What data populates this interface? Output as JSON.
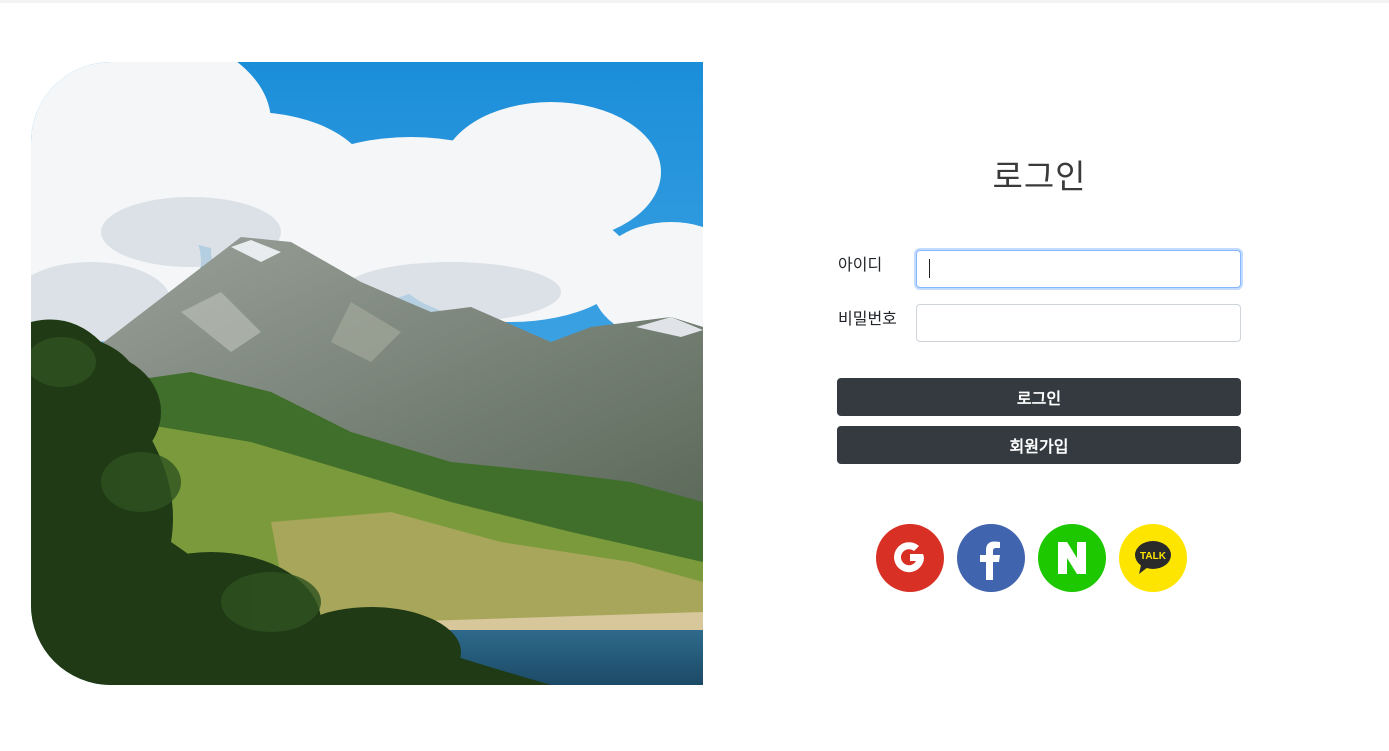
{
  "login": {
    "title": "로그인",
    "id_label": "아이디",
    "password_label": "비밀번호",
    "id_value": "",
    "password_value": "",
    "login_button": "로그인",
    "signup_button": "회원가입"
  },
  "hero": {
    "icon": "mountain-landscape-photo"
  },
  "social": [
    {
      "name": "google",
      "icon": "google-icon",
      "color": "#d93025"
    },
    {
      "name": "facebook",
      "icon": "facebook-icon",
      "color": "#4064ad"
    },
    {
      "name": "naver",
      "icon": "naver-icon",
      "color": "#1ec800"
    },
    {
      "name": "kakao",
      "icon": "kakaotalk-icon",
      "color": "#fee500",
      "text": "TALK"
    }
  ],
  "colors": {
    "button_bg": "#343a40",
    "input_focus": "#86b7fe"
  }
}
